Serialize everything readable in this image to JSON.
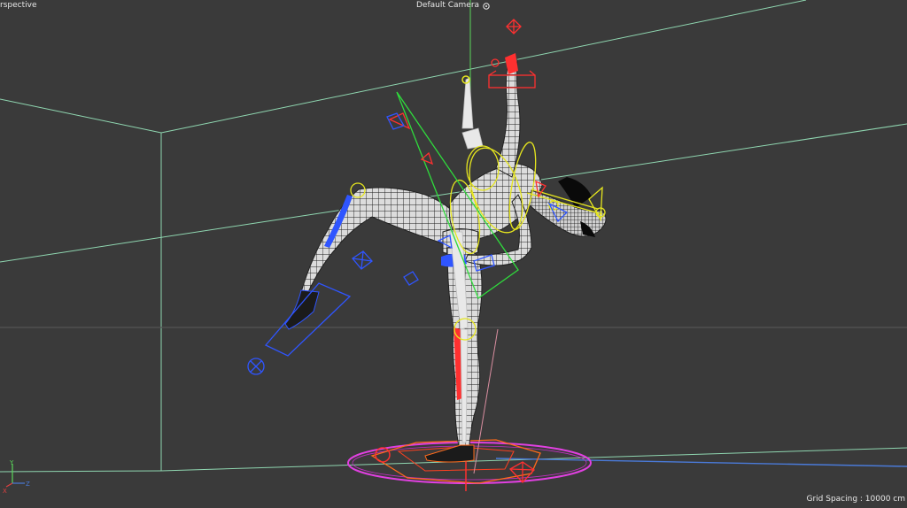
{
  "viewport": {
    "view_mode": "rspective",
    "camera_label": "Default Camera",
    "camera_icon": "camera-target-icon",
    "grid_spacing": "Grid Spacing : 10000 cm"
  },
  "axis_gizmo": {
    "y_label": "Y",
    "x_label": "X",
    "z_label": "Z"
  },
  "colors": {
    "background": "#3a3a3a",
    "floor_lines": "#8fd6b0",
    "x_axis": "#e04040",
    "y_axis": "#5ad65a",
    "z_axis": "#4a7ad8",
    "ik_controls_left": "#2f55ff",
    "ik_controls_right": "#ff3030",
    "bone_rings": "#e6e61e",
    "ground_circle": "#e040e0",
    "mesh_wire": "#1a1a1a",
    "mesh_fill": "#d9d9d9"
  }
}
